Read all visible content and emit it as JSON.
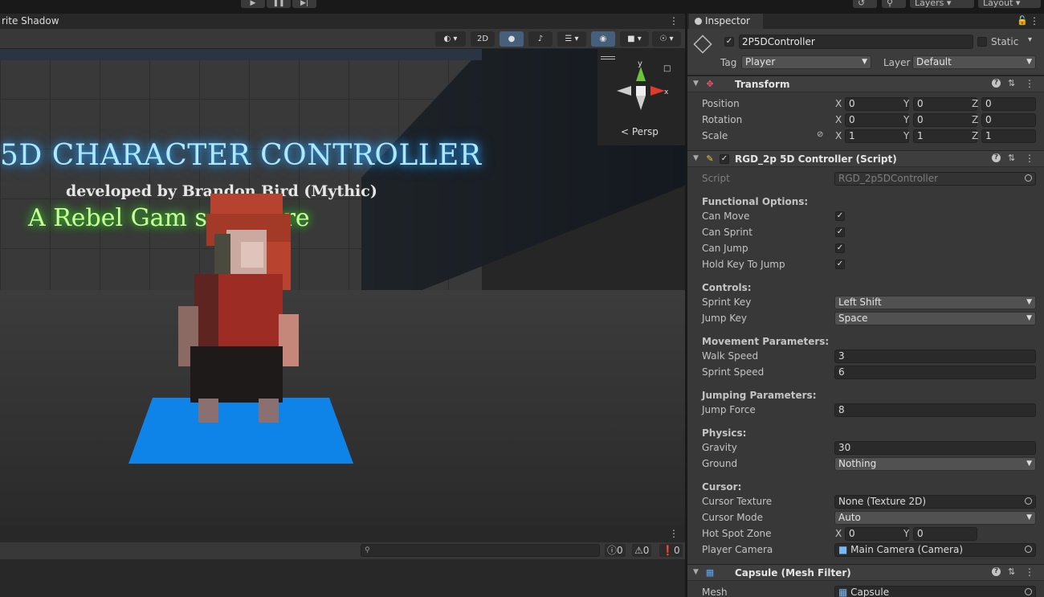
{
  "toolbar": {
    "layers_label": "Layers",
    "layout_label": "Layout"
  },
  "scene": {
    "tab_label": "rite Shadow",
    "tool_2d": "2D",
    "gizmo_label": "Persp",
    "axis_y": "y",
    "axis_x": "x",
    "banner_title": "5D CHARACTER CONTROLLER",
    "banner_dev": "developed by Brandon Bird (Mythic)",
    "banner_feature": "A Rebel Gam         s Feature"
  },
  "console": {
    "count_info": "0",
    "count_warn": "0",
    "count_error": "0"
  },
  "inspector": {
    "tab_label": "Inspector",
    "object_name": "2P5DController",
    "static_label": "Static",
    "tag_label": "Tag",
    "tag_value": "Player",
    "layer_label": "Layer",
    "layer_value": "Default",
    "transform": {
      "title": "Transform",
      "position_label": "Position",
      "rotation_label": "Rotation",
      "scale_label": "Scale",
      "x": "X",
      "y": "Y",
      "z": "Z",
      "position": [
        "0",
        "0",
        "0"
      ],
      "rotation": [
        "0",
        "0",
        "0"
      ],
      "scale": [
        "1",
        "1",
        "1"
      ]
    },
    "script_comp": {
      "title": "RGD_2p 5D Controller (Script)",
      "script_label": "Script",
      "script_value": "RGD_2p5DController",
      "functional_header": "Functional Options:",
      "can_move": "Can Move",
      "can_sprint": "Can Sprint",
      "can_jump": "Can Jump",
      "hold_key": "Hold Key To Jump",
      "controls_header": "Controls:",
      "sprint_key_label": "Sprint Key",
      "sprint_key_value": "Left Shift",
      "jump_key_label": "Jump Key",
      "jump_key_value": "Space",
      "movement_header": "Movement Parameters:",
      "walk_speed_label": "Walk Speed",
      "walk_speed_value": "3",
      "sprint_speed_label": "Sprint Speed",
      "sprint_speed_value": "6",
      "jumping_header": "Jumping Parameters:",
      "jump_force_label": "Jump Force",
      "jump_force_value": "8",
      "physics_header": "Physics:",
      "gravity_label": "Gravity",
      "gravity_value": "30",
      "ground_label": "Ground",
      "ground_value": "Nothing",
      "cursor_header": "Cursor:",
      "cursor_texture_label": "Cursor Texture",
      "cursor_texture_value": "None (Texture 2D)",
      "cursor_mode_label": "Cursor Mode",
      "cursor_mode_value": "Auto",
      "hotspot_label": "Hot Spot Zone",
      "hotspot_x": "0",
      "hotspot_y": "0",
      "player_camera_label": "Player Camera",
      "player_camera_value": "Main Camera (Camera)"
    },
    "mesh_filter": {
      "title": "Capsule (Mesh Filter)",
      "mesh_label": "Mesh",
      "mesh_value": "Capsule"
    }
  }
}
